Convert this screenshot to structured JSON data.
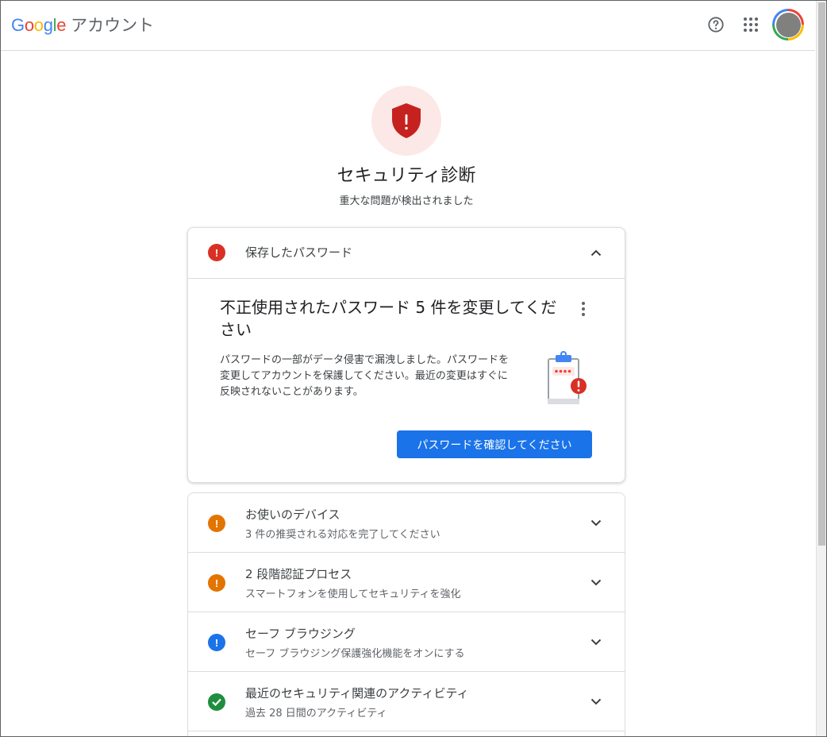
{
  "header": {
    "brand_letters": [
      {
        "char": "G",
        "color": "#4285f4"
      },
      {
        "char": "o",
        "color": "#ea4335"
      },
      {
        "char": "o",
        "color": "#fbbc04"
      },
      {
        "char": "g",
        "color": "#4285f4"
      },
      {
        "char": "l",
        "color": "#34a853"
      },
      {
        "char": "e",
        "color": "#ea4335"
      }
    ],
    "product": "アカウント",
    "icons": [
      "help-icon",
      "apps-grid-icon"
    ]
  },
  "hero": {
    "icon": "shield-alert-icon",
    "title": "セキュリティ診断",
    "subtitle": "重大な問題が検出されました"
  },
  "passwords_card": {
    "header_title": "保存したパスワード",
    "status": "critical",
    "expanded": true,
    "detail_title": "不正使用されたパスワード 5 件を変更してください",
    "detail_body": "パスワードの一部がデータ侵害で漏洩しました。パスワードを変更してアカウントを保護してください。最近の変更はすぐに反映されないことがあります。",
    "illustration": "clipboard-password-alert-icon",
    "button_label": "パスワードを確認してください"
  },
  "checks": [
    {
      "title": "お使いのデバイス",
      "subtitle": "3 件の推奨される対応を完了してください",
      "status": "warning"
    },
    {
      "title": "2 段階認証プロセス",
      "subtitle": "スマートフォンを使用してセキュリティを強化",
      "status": "warning"
    },
    {
      "title": "セーフ ブラウジング",
      "subtitle": "セーフ ブラウジング保護強化機能をオンにする",
      "status": "info"
    },
    {
      "title": "最近のセキュリティ関連のアクティビティ",
      "subtitle": "過去 28 日間のアクティビティ",
      "status": "ok"
    }
  ],
  "colors": {
    "critical": "#d93025",
    "warning": "#e37400",
    "info": "#1a73e8",
    "ok": "#1e8e3e",
    "shield": "#c5221f",
    "badge_bg": "#fce8e6"
  }
}
